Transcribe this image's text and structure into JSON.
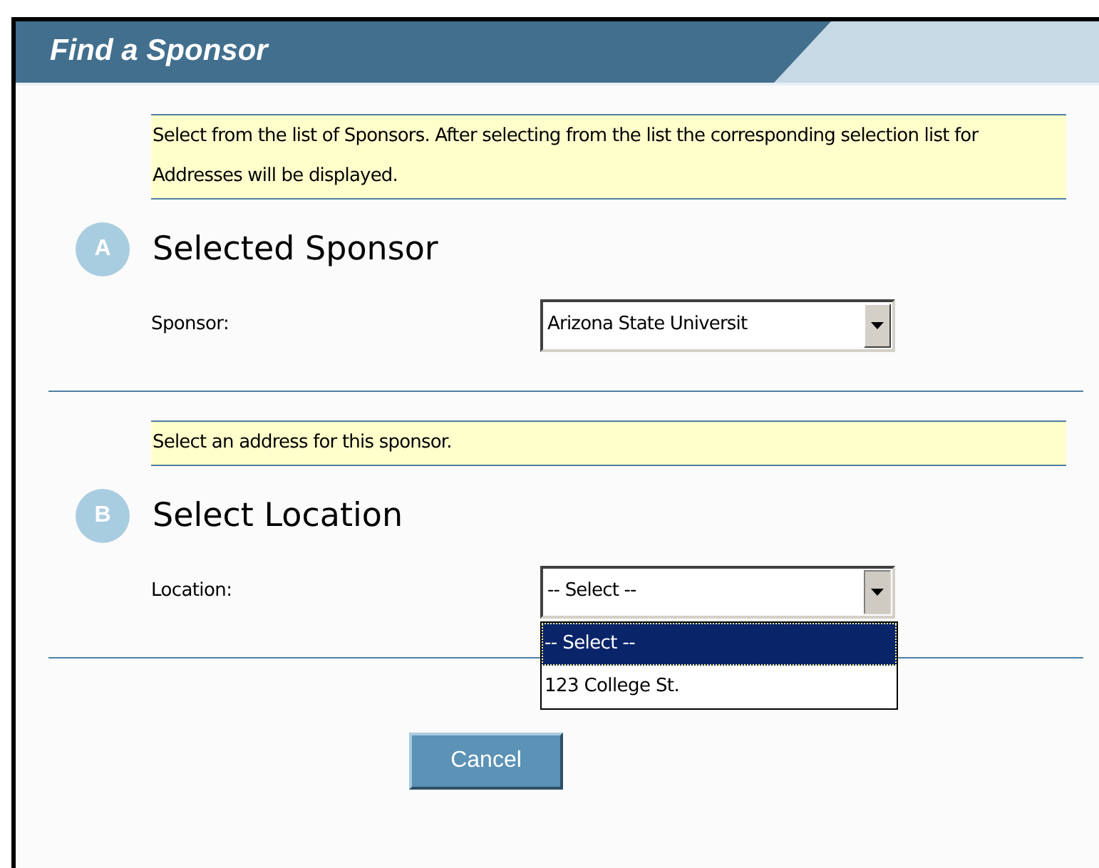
{
  "window": {
    "title": "Find a Sponsor"
  },
  "sections": [
    {
      "note": "Select from the list of Sponsors. After selecting from the list the corresponding selection list for Addresses will be displayed.",
      "badge": "A",
      "heading": "Selected Sponsor",
      "field": {
        "label": "Sponsor:",
        "value": "Arizona State Universit",
        "expanded": false
      }
    },
    {
      "note": "Select an address for this sponsor.",
      "badge": "B",
      "heading": "Select Location",
      "field": {
        "label": "Location:",
        "value": "-- Select --",
        "expanded": true,
        "options": [
          {
            "label": "-- Select --",
            "selected": true
          },
          {
            "label": "123 College St.",
            "selected": false
          }
        ]
      }
    }
  ],
  "buttons": [
    "Cancel"
  ]
}
